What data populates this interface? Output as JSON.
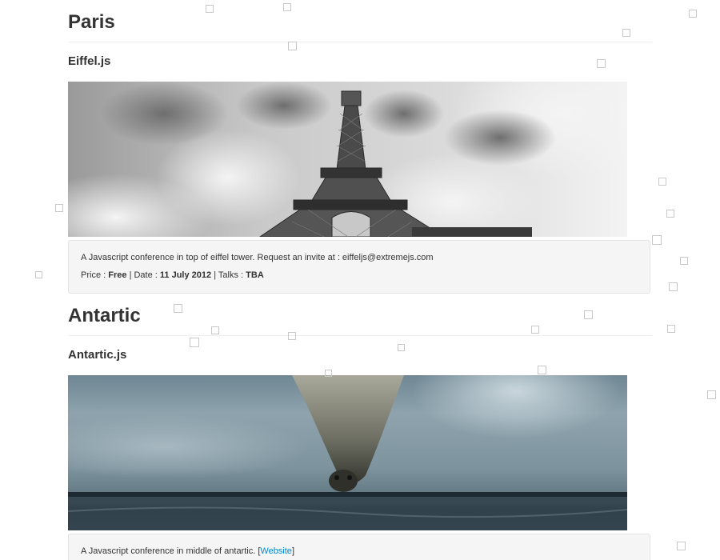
{
  "sections": [
    {
      "city": "Paris",
      "conference": "Eiffel.js",
      "description": "A Javascript conference in top of eiffel tower. Request an invite at : eiffeljs@extremejs.com",
      "price_label": "Price :",
      "price": "Free",
      "date_label": "Date :",
      "date": "11 July 2012",
      "talks_label": "Talks :",
      "talks": "TBA",
      "separator": "|",
      "image": "eiffel-tower-photo"
    },
    {
      "city": "Antartic",
      "conference": "Antartic.js",
      "description_prefix": "A Javascript conference in middle of antartic. [",
      "link_text": "Website",
      "description_suffix": "]",
      "image": "seal-under-ice-photo"
    }
  ],
  "colors": {
    "link": "#0088cc",
    "panel_bg": "#f5f5f5",
    "square_border": "#c8c8c8"
  }
}
